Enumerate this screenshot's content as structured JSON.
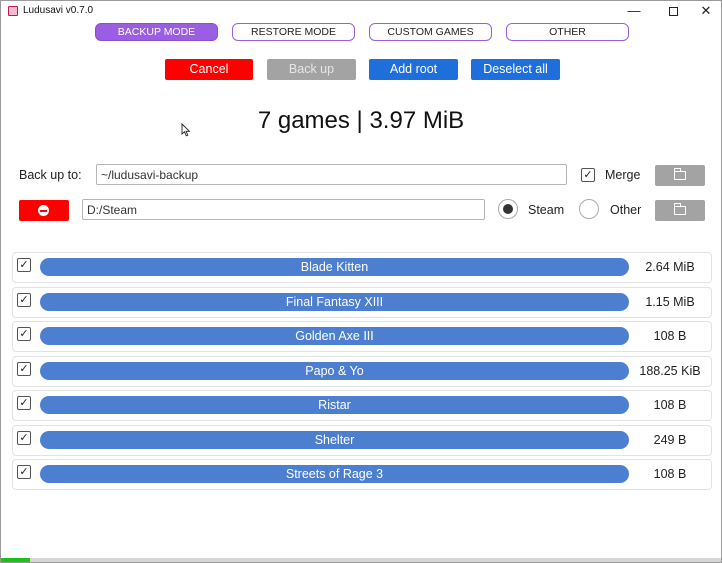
{
  "window": {
    "title": "Ludusavi v0.7.0",
    "min_icon": "minimize-icon",
    "max_icon": "maximize-icon",
    "close_icon": "close-icon"
  },
  "modes": [
    {
      "label": "BACKUP MODE",
      "active": true
    },
    {
      "label": "RESTORE MODE",
      "active": false
    },
    {
      "label": "CUSTOM GAMES",
      "active": false
    },
    {
      "label": "OTHER",
      "active": false
    }
  ],
  "actions": {
    "cancel": "Cancel",
    "backup": "Back up",
    "add_root": "Add root",
    "deselect_all": "Deselect all"
  },
  "summary": "7 games | 3.97 MiB",
  "backup_target": {
    "label": "Back up to:",
    "path": "~/ludusavi-backup",
    "merge_label": "Merge",
    "merge_checked": true
  },
  "root": {
    "path": "D:/Steam",
    "store_options": [
      "Steam",
      "Other"
    ],
    "selected_store": "Steam"
  },
  "games": [
    {
      "name": "Blade Kitten",
      "size": "2.64 MiB",
      "checked": true
    },
    {
      "name": "Final Fantasy XIII",
      "size": "1.15 MiB",
      "checked": true
    },
    {
      "name": "Golden Axe III",
      "size": "108 B",
      "checked": true
    },
    {
      "name": "Papo & Yo",
      "size": "188.25 KiB",
      "checked": true
    },
    {
      "name": "Ristar",
      "size": "108 B",
      "checked": true
    },
    {
      "name": "Shelter",
      "size": "249 B",
      "checked": true
    },
    {
      "name": "Streets of Rage 3",
      "size": "108 B",
      "checked": true
    }
  ],
  "progress": {
    "fraction": 0.04
  },
  "colors": {
    "accent": "#9a5ee3",
    "danger": "#fe0000",
    "primary": "#1e6fdc",
    "disabled": "#a3a3a3",
    "game_bar": "#4d7fd0",
    "progress": "#18c418"
  }
}
